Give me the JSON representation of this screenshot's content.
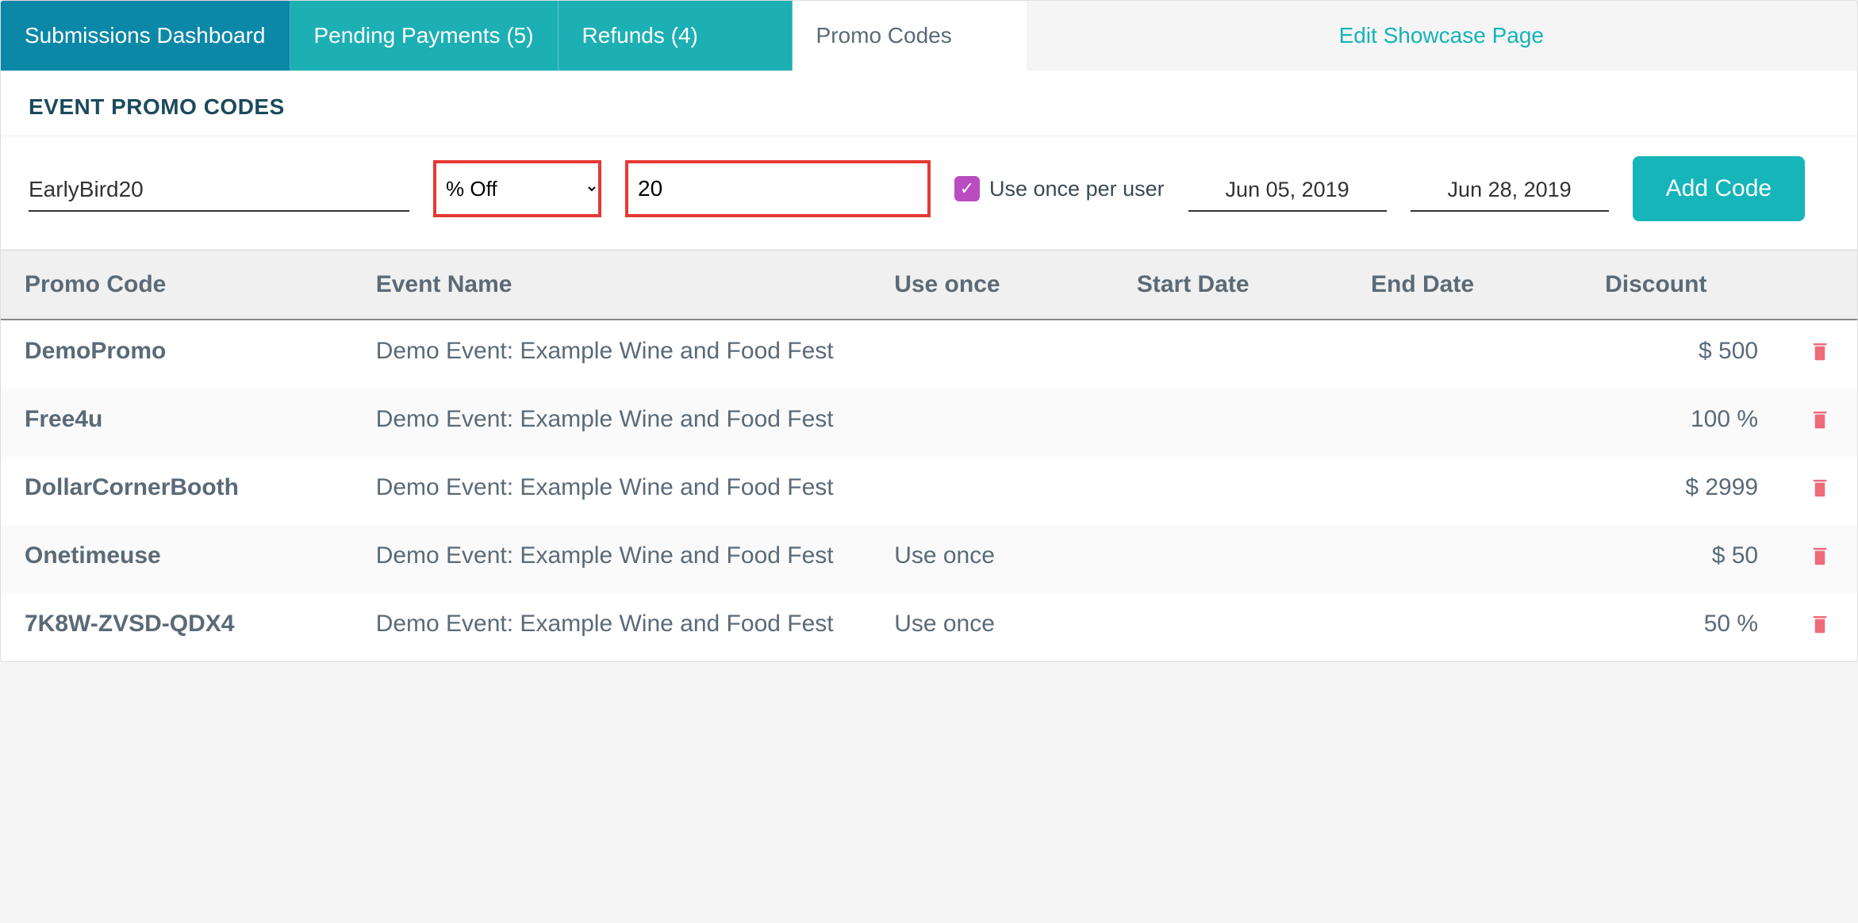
{
  "tabs": {
    "submissions": "Submissions Dashboard",
    "pending": "Pending Payments (5)",
    "refunds": "Refunds (4)",
    "promo": "Promo Codes",
    "edit_showcase": "Edit Showcase Page"
  },
  "section_title": "EVENT PROMO CODES",
  "form": {
    "code_value": "EarlyBird20",
    "discount_type": "% Off",
    "amount_value": "20",
    "use_once_label": "Use once per user",
    "use_once_checked": true,
    "start_date": "Jun 05, 2019",
    "end_date": "Jun 28, 2019",
    "add_button": "Add Code"
  },
  "table": {
    "headers": {
      "code": "Promo Code",
      "event": "Event Name",
      "use_once": "Use once",
      "start": "Start Date",
      "end": "End Date",
      "discount": "Discount"
    },
    "rows": [
      {
        "code": "DemoPromo",
        "event": "Demo Event: Example Wine and Food Fest",
        "use_once": "",
        "start": "",
        "end": "",
        "discount": "$ 500"
      },
      {
        "code": "Free4u",
        "event": "Demo Event: Example Wine and Food Fest",
        "use_once": "",
        "start": "",
        "end": "",
        "discount": "100 %"
      },
      {
        "code": "DollarCornerBooth",
        "event": "Demo Event: Example Wine and Food Fest",
        "use_once": "",
        "start": "",
        "end": "",
        "discount": "$ 2999"
      },
      {
        "code": "Onetimeuse",
        "event": "Demo Event: Example Wine and Food Fest",
        "use_once": "Use once",
        "start": "",
        "end": "",
        "discount": "$ 50"
      },
      {
        "code": "7K8W-ZVSD-QDX4",
        "event": "Demo Event: Example Wine and Food Fest",
        "use_once": "Use once",
        "start": "",
        "end": "",
        "discount": "50 %"
      }
    ]
  }
}
